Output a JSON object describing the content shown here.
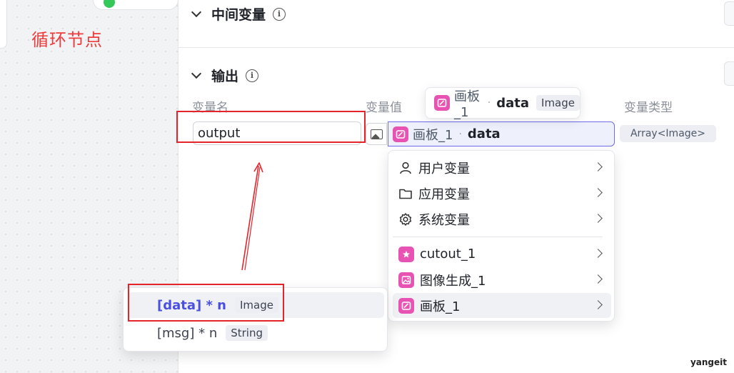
{
  "annotation": {
    "title": "循环节点"
  },
  "sections": {
    "intermediate": {
      "title": "中间变量"
    },
    "output": {
      "title": "输出"
    }
  },
  "columns": {
    "name": "变量名",
    "value": "变量值",
    "type": "变量类型"
  },
  "output_row": {
    "name_value": "output",
    "ref_node": "画板_1",
    "ref_sep": "·",
    "ref_field": "data",
    "type_tag": "Array<Image>"
  },
  "tooltip": {
    "node": "画板_1",
    "sep": "·",
    "field": "data",
    "type": "Image"
  },
  "menu": {
    "items": [
      {
        "label": "用户变量",
        "icon": "user-icon"
      },
      {
        "label": "应用变量",
        "icon": "folder-icon"
      },
      {
        "label": "系统变量",
        "icon": "gear-icon"
      },
      {
        "label": "cutout_1",
        "icon": "cutout-node-icon"
      },
      {
        "label": "图像生成_1",
        "icon": "image-gen-node-icon"
      },
      {
        "label": "画板_1",
        "icon": "canvas-node-icon"
      }
    ]
  },
  "submenu": {
    "items": [
      {
        "field": "[data] * n",
        "type": "Image"
      },
      {
        "field": "[msg] * n",
        "type": "String"
      }
    ]
  },
  "watermark": "yangeit",
  "colors": {
    "accent": "#4b4fe0",
    "node_pink": "#e752b3",
    "annotation_red": "#e5232a"
  }
}
